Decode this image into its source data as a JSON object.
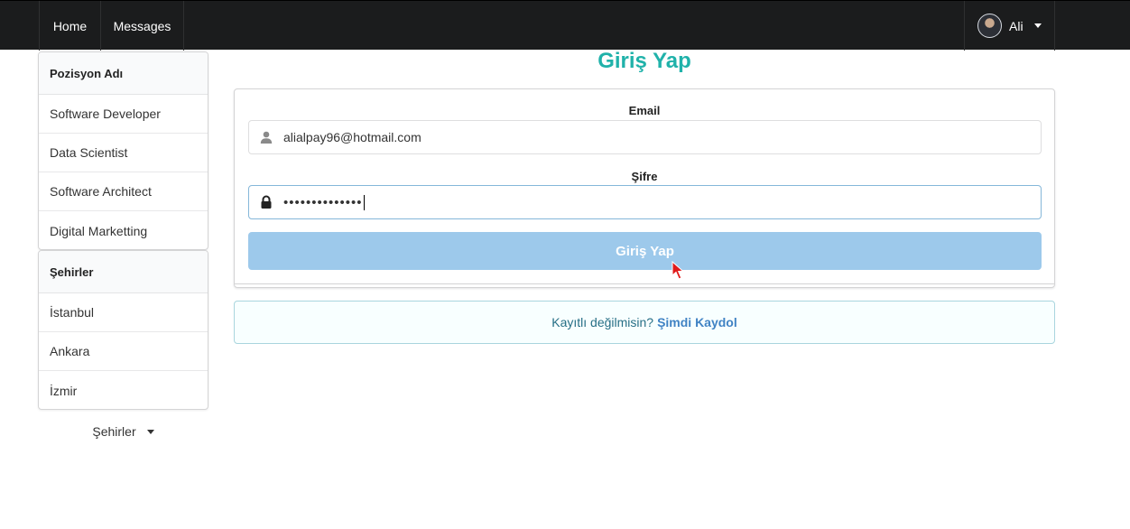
{
  "nav": {
    "home": "Home",
    "messages": "Messages",
    "user": "Ali"
  },
  "sidebar": {
    "positions": {
      "header": "Pozisyon Adı",
      "items": [
        "Software Developer",
        "Data Scientist",
        "Software Architect",
        "Digital Marketting"
      ]
    },
    "cities": {
      "header": "Şehirler",
      "items": [
        "İstanbul",
        "Ankara",
        "İzmir"
      ]
    },
    "city_dropdown": "Şehirler"
  },
  "login": {
    "title": "Giriş Yap",
    "email_label": "Email",
    "email_value": "alialpay96@hotmail.com",
    "password_label": "Şifre",
    "password_value": "••••••••••••••",
    "submit_label": "Giriş Yap"
  },
  "register": {
    "prompt": "Kayıtlı değilmisin?",
    "link": "Şimdi Kaydol"
  },
  "icons": {
    "user": "user-icon",
    "lock": "lock-icon",
    "dropdown": "caret-down-icon",
    "pointer": "mouse-pointer-icon"
  },
  "colors": {
    "topbar": "#1b1c1d",
    "title": "#20b2aa",
    "submit_button": "#9dc9eb",
    "link": "#4183c4",
    "message_text": "#276f86",
    "message_bg": "#f8ffff",
    "pointer": "#e01b1b"
  }
}
